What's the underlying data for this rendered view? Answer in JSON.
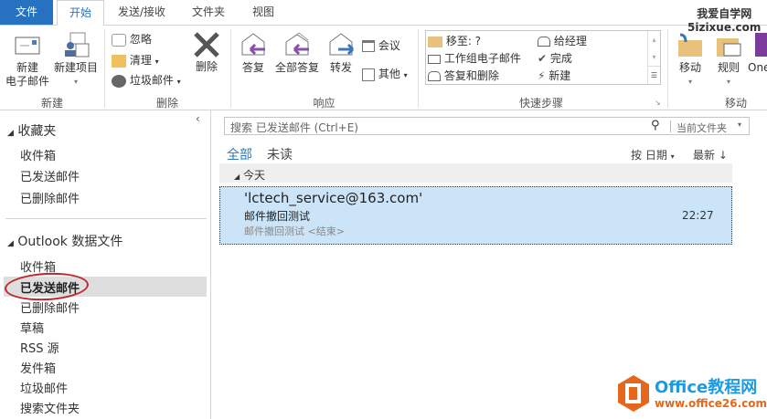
{
  "tabs": {
    "file": "文件",
    "home": "开始",
    "send_receive": "发送/接收",
    "folder": "文件夹",
    "view": "视图"
  },
  "watermark_top": {
    "line1": "我爱自学网",
    "line2": "5izixue.com"
  },
  "ribbon": {
    "new_email": [
      "新建",
      "电子邮件"
    ],
    "new_items": "新建项目",
    "group_new": "新建",
    "ignore": "忽略",
    "cleanup": "清理",
    "junk": "垃圾邮件",
    "delete": "删除",
    "group_delete": "删除",
    "reply": "答复",
    "reply_all": "全部答复",
    "forward": "转发",
    "meeting": "会议",
    "more": "其他",
    "group_respond": "响应",
    "quick_steps": {
      "move_to": "移至: ?",
      "team_email": "工作组电子邮件",
      "reply_delete": "答复和删除",
      "to_manager": "给经理",
      "done": "完成",
      "create_new": "新建"
    },
    "group_quick": "快速步骤",
    "move": "移动",
    "rules": "规则",
    "onenote": "One",
    "group_move": "移动"
  },
  "nav": {
    "favorites": "收藏夹",
    "fav_items": [
      "收件箱",
      "已发送邮件",
      "已删除邮件"
    ],
    "datafile": "Outlook 数据文件",
    "items": [
      "收件箱",
      "已发送邮件",
      "已删除邮件",
      "草稿",
      "RSS 源",
      "发件箱",
      "垃圾邮件",
      "搜索文件夹"
    ]
  },
  "search": {
    "placeholder": "搜索 已发送邮件 (Ctrl+E)",
    "scope": "当前文件夹"
  },
  "filters": {
    "all": "全部",
    "unread": "未读",
    "sort_by": "按 日期",
    "order": "最新 ↓"
  },
  "group": "今天",
  "mail": {
    "to": "'lctech_service@163.com'",
    "subject": "邮件撤回测试",
    "preview": "邮件撤回测试 <结束>",
    "time": "22:27"
  },
  "watermark_bottom": {
    "title": "Office教程网",
    "url": "www.office26.com"
  },
  "colors": {
    "file_tab": "#2672c0",
    "selected_mail": "#cce4f7",
    "accent": "#2b79c2"
  }
}
